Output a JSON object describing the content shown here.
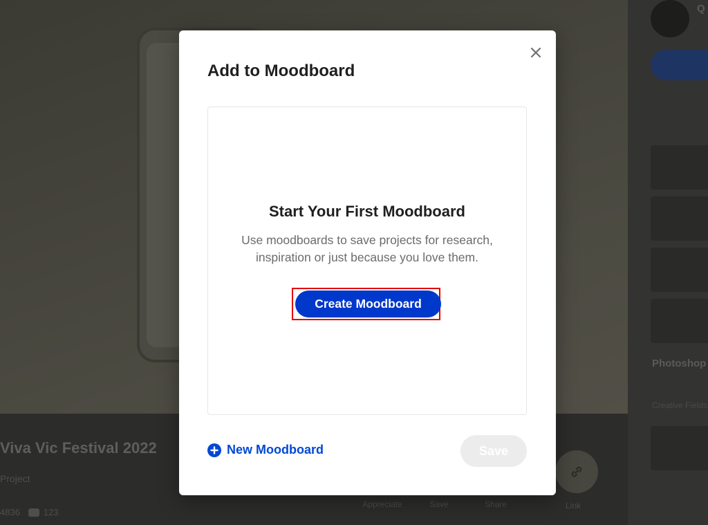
{
  "background": {
    "project_title": "Viva Vic Festival 2022",
    "project_owner": "Project",
    "stats": {
      "appreciations": "4836",
      "comments": "123"
    },
    "actions": [
      "Appreciate",
      "Save",
      "Share"
    ],
    "link_label": "Link",
    "author_initial": "Q",
    "sidebar_title": "Photoshop",
    "sidebar_sub": "Creative Fields"
  },
  "modal": {
    "title": "Add to Moodboard",
    "close_icon": "close-icon",
    "empty_state": {
      "title": "Start Your First Moodboard",
      "description_line1": "Use moodboards to save projects for research,",
      "description_line2": "inspiration or just because you love them.",
      "create_button": "Create Moodboard"
    },
    "new_moodboard_label": "New Moodboard",
    "save_label": "Save"
  },
  "colors": {
    "primary": "#0038cc",
    "link": "#0048d6",
    "highlight": "#e00000"
  }
}
